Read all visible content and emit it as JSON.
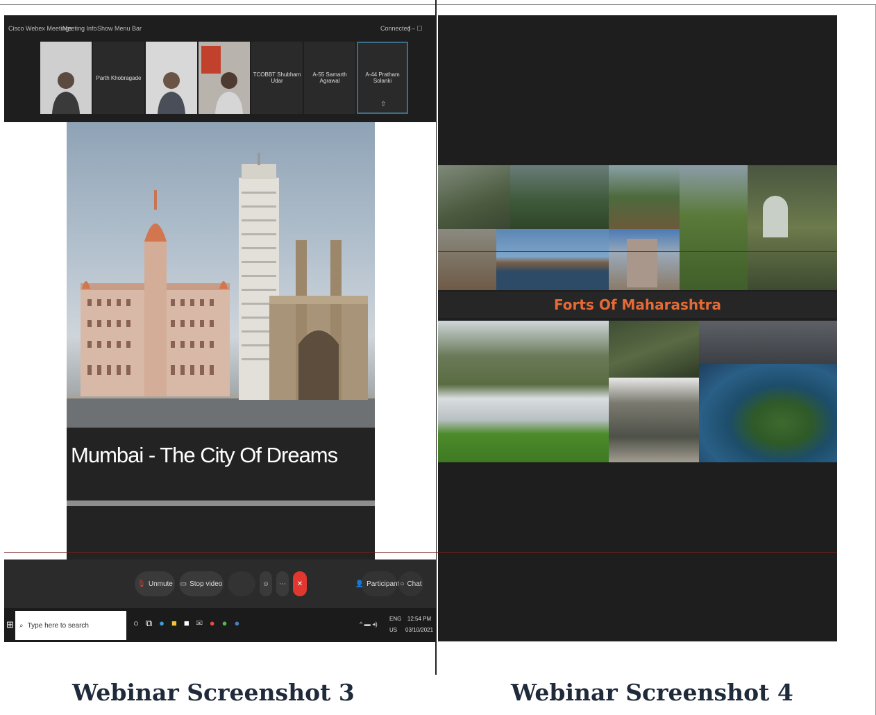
{
  "left_screenshot": {
    "titlebar": {
      "app_name": "Cisco Webex Meetings",
      "meeting_info": "Meeting Info",
      "show_menu_bar": "Show Menu Bar",
      "connected": "Connected"
    },
    "participants_tiles": [
      {
        "name": "",
        "type": "camera"
      },
      {
        "name": "Parth Khobragade",
        "type": "name"
      },
      {
        "name": "",
        "type": "camera"
      },
      {
        "name": "",
        "type": "camera"
      },
      {
        "name": "TCOBBT Shubham Udar",
        "type": "name"
      },
      {
        "name": "A-55 Samarth Agrawal",
        "type": "name"
      },
      {
        "name": "A-44 Pratham Solanki",
        "type": "name"
      }
    ],
    "slide_caption": "Mumbai - The City Of Dreams",
    "controls": {
      "unmute": "Unmute",
      "stop_video": "Stop video",
      "participants": "Participants",
      "chat": "Chat"
    },
    "taskbar": {
      "search_placeholder": "Type here to search",
      "language": "ENG",
      "region": "US",
      "time": "12:54 PM",
      "date": "03/10/2021"
    }
  },
  "right_screenshot": {
    "slide_title": "Forts Of Maharashtra"
  },
  "labels": {
    "left": "Webinar Screenshot 3",
    "right": "Webinar Screenshot 4"
  },
  "colors": {
    "window_bg": "#1e1e1e",
    "slide_title_color": "#e66a35",
    "leave_button": "#e0382e",
    "label_color": "#1f2a3a"
  }
}
